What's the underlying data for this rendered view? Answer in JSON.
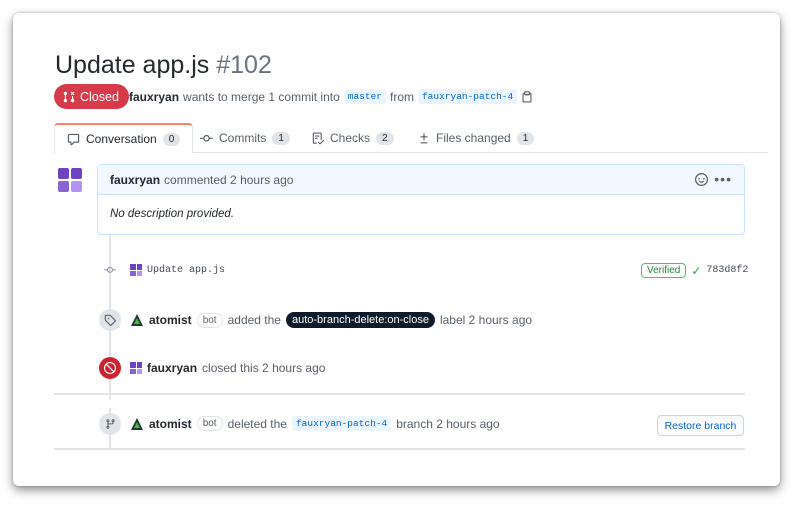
{
  "pr": {
    "title": "Update app.js",
    "number": "#102",
    "state": "Closed",
    "author": "fauxryan",
    "merge_text": "wants to merge 1 commit into",
    "base_branch": "master",
    "from_text": "from",
    "head_branch": "fauxryan-patch-4"
  },
  "tabs": [
    {
      "label": "Conversation",
      "count": "0",
      "icon": "comment-icon"
    },
    {
      "label": "Commits",
      "count": "1",
      "icon": "commit-icon"
    },
    {
      "label": "Checks",
      "count": "2",
      "icon": "checklist-icon"
    },
    {
      "label": "Files changed",
      "count": "1",
      "icon": "diff-icon"
    }
  ],
  "comment": {
    "author": "fauxryan",
    "action": "commented 2 hours ago",
    "body": "No description provided."
  },
  "timeline": {
    "commit": {
      "message": "Update app.js",
      "verified": "Verified",
      "sha": "783d8f2"
    },
    "label_event": {
      "actor": "atomist",
      "bot": "bot",
      "action": "added the",
      "label": "auto-branch-delete:on-close",
      "suffix": "label 2 hours ago"
    },
    "close_event": {
      "actor": "fauxryan",
      "action": "closed this 2 hours ago"
    },
    "delete_event": {
      "actor": "atomist",
      "bot": "bot",
      "action": "deleted the",
      "branch": "fauxryan-patch-4",
      "suffix": "branch 2 hours ago",
      "button": "Restore branch"
    }
  },
  "colors": {
    "closed_red": "#d73a49",
    "link_blue": "#0366d6",
    "label_dark": "#0e1b2a",
    "avatar_purple": "#6f42c1"
  }
}
